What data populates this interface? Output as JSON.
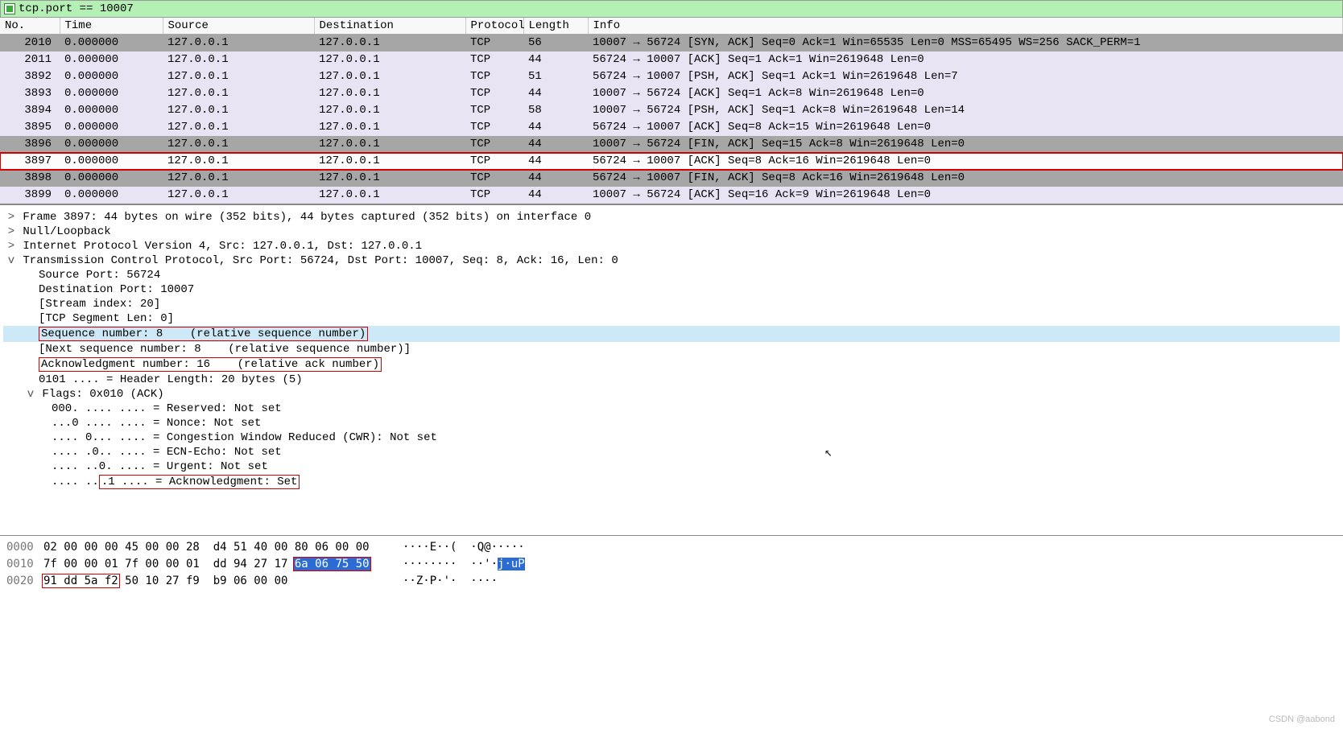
{
  "filter": {
    "text": "tcp.port == 10007"
  },
  "columns": {
    "no": "No.",
    "time": "Time",
    "source": "Source",
    "destination": "Destination",
    "protocol": "Protocol",
    "length": "Length",
    "info": "Info"
  },
  "packets": [
    {
      "no": "2010",
      "time": "0.000000",
      "src": "127.0.0.1",
      "dst": "127.0.0.1",
      "proto": "TCP",
      "len": "56",
      "info": "10007 → 56724 [SYN, ACK] Seq=0 Ack=1 Win=65535 Len=0 MSS=65495 WS=256 SACK_PERM=1",
      "cls": "bg-grey"
    },
    {
      "no": "2011",
      "time": "0.000000",
      "src": "127.0.0.1",
      "dst": "127.0.0.1",
      "proto": "TCP",
      "len": "44",
      "info": "56724 → 10007 [ACK] Seq=1 Ack=1 Win=2619648 Len=0",
      "cls": "bg-lav"
    },
    {
      "no": "3892",
      "time": "0.000000",
      "src": "127.0.0.1",
      "dst": "127.0.0.1",
      "proto": "TCP",
      "len": "51",
      "info": "56724 → 10007 [PSH, ACK] Seq=1 Ack=1 Win=2619648 Len=7",
      "cls": "bg-lav"
    },
    {
      "no": "3893",
      "time": "0.000000",
      "src": "127.0.0.1",
      "dst": "127.0.0.1",
      "proto": "TCP",
      "len": "44",
      "info": "10007 → 56724 [ACK] Seq=1 Ack=8 Win=2619648 Len=0",
      "cls": "bg-lav"
    },
    {
      "no": "3894",
      "time": "0.000000",
      "src": "127.0.0.1",
      "dst": "127.0.0.1",
      "proto": "TCP",
      "len": "58",
      "info": "10007 → 56724 [PSH, ACK] Seq=1 Ack=8 Win=2619648 Len=14",
      "cls": "bg-lav"
    },
    {
      "no": "3895",
      "time": "0.000000",
      "src": "127.0.0.1",
      "dst": "127.0.0.1",
      "proto": "TCP",
      "len": "44",
      "info": "56724 → 10007 [ACK] Seq=8 Ack=15 Win=2619648 Len=0",
      "cls": "bg-lav"
    },
    {
      "no": "3896",
      "time": "0.000000",
      "src": "127.0.0.1",
      "dst": "127.0.0.1",
      "proto": "TCP",
      "len": "44",
      "info": "10007 → 56724 [FIN, ACK] Seq=15 Ack=8 Win=2619648 Len=0",
      "cls": "bg-grey"
    },
    {
      "no": "3897",
      "time": "0.000000",
      "src": "127.0.0.1",
      "dst": "127.0.0.1",
      "proto": "TCP",
      "len": "44",
      "info": "56724 → 10007 [ACK] Seq=8 Ack=16 Win=2619648 Len=0",
      "cls": "bg-sel",
      "sel": true
    },
    {
      "no": "3898",
      "time": "0.000000",
      "src": "127.0.0.1",
      "dst": "127.0.0.1",
      "proto": "TCP",
      "len": "44",
      "info": "56724 → 10007 [FIN, ACK] Seq=8 Ack=16 Win=2619648 Len=0",
      "cls": "bg-grey"
    },
    {
      "no": "3899",
      "time": "0.000000",
      "src": "127.0.0.1",
      "dst": "127.0.0.1",
      "proto": "TCP",
      "len": "44",
      "info": "10007 → 56724 [ACK] Seq=16 Ack=9 Win=2619648 Len=0",
      "cls": "bg-lav"
    }
  ],
  "detail": {
    "frame": "Frame 3897: 44 bytes on wire (352 bits), 44 bytes captured (352 bits) on interface 0",
    "null": "Null/Loopback",
    "ip": "Internet Protocol Version 4, Src: 127.0.0.1, Dst: 127.0.0.1",
    "tcp": "Transmission Control Protocol, Src Port: 56724, Dst Port: 10007, Seq: 8, Ack: 16, Len: 0",
    "srcport": "Source Port: 56724",
    "dstport": "Destination Port: 10007",
    "stream": "[Stream index: 20]",
    "seglen": "[TCP Segment Len: 0]",
    "seq": "Sequence number: 8    (relative sequence number)",
    "nextseq": "[Next sequence number: 8    (relative sequence number)]",
    "ack": "Acknowledgment number: 16    (relative ack number)",
    "hdrlen": "0101 .... = Header Length: 20 bytes (5)",
    "flags": "Flags: 0x010 (ACK)",
    "f_res": "000. .... .... = Reserved: Not set",
    "f_nonce": "...0 .... .... = Nonce: Not set",
    "f_cwr": ".... 0... .... = Congestion Window Reduced (CWR): Not set",
    "f_ecn": ".... .0.. .... = ECN-Echo: Not set",
    "f_urg": ".... ..0. .... = Urgent: Not set",
    "f_ack": ".... ...1 .... = Acknowledgment: Set",
    "f_ack_pre": ".... ..",
    "f_ack_box": ".1 .... = Acknowledgment: Set"
  },
  "hex": {
    "r0": {
      "off": "0000",
      "b": "02 00 00 00 45 00 00 28  d4 51 40 00 80 06 00 00",
      "a": "····E··(  ·Q@·····"
    },
    "r1": {
      "off": "0010",
      "b1": "7f 00 00 01 7f 00 00 01  dd 94 27 17 ",
      "b2": "6a 06 75 50",
      "a1": "········  ··'·",
      "a2": "j·uP"
    },
    "r2": {
      "off": "0020",
      "b1": "91 dd 5a f2",
      "b2": " 50 10 27 f9  b9 06 00 00",
      "a": "··Z·P·'·  ····"
    }
  },
  "watermark": "CSDN @aabond"
}
